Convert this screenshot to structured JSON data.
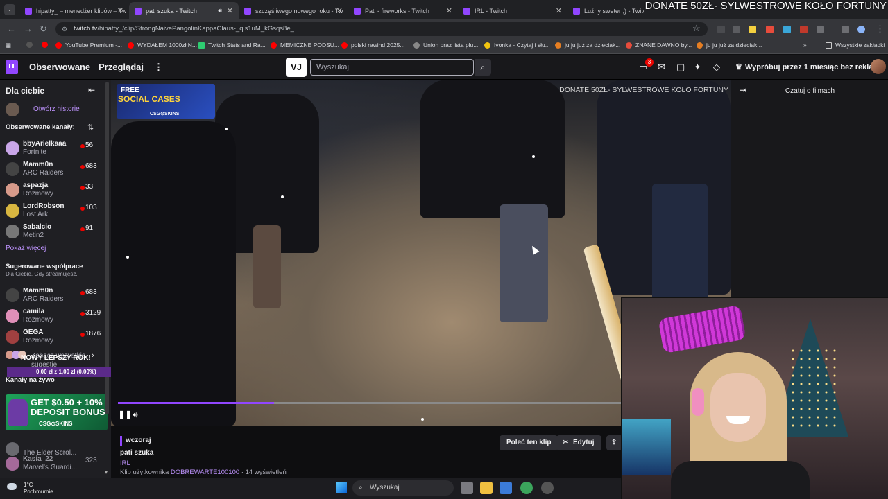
{
  "browser": {
    "tabs": [
      {
        "label": "hipatty_ – menedżer klipów – Tw",
        "active": false
      },
      {
        "label": "pati szuka - Twitch",
        "active": true
      },
      {
        "label": "szczęśliwego nowego roku - Tw",
        "active": false
      },
      {
        "label": "Pati - fireworks - Twitch",
        "active": false
      },
      {
        "label": "IRL - Twitch",
        "active": false
      },
      {
        "label": "Luźny sweter ;) - Twitch",
        "active": false
      }
    ],
    "url_host": "twitch.tv",
    "url_path": "/hipatty_/clip/StrongNaivePangolinKappaClaus-_qis1uM_kGsqs8e_",
    "bookmarks": [
      "YouTube Premium -...",
      "WYDAŁEM 1000zł N...",
      "Twitch Stats and Ra...",
      "MEMICZNE PODSU...",
      "polski rewind 2025...",
      "Union oraz lista plu...",
      "Ivonka - Czytaj i słu...",
      "ju ju już za dzieciak...",
      "ZNANE DAWNO by...",
      "ju ju już za dzieciak..."
    ],
    "all_bookmarks": "Wszystkie zakładki"
  },
  "stream_banner": "DONATE 50ZŁ- SYLWESTROWE KOŁO FORTUNY",
  "twitch_nav": {
    "following": "Obserwowane",
    "browse": "Przeglądaj",
    "search_placeholder": "Wyszukaj",
    "extension_label": "VJ",
    "notifications_count": "3",
    "promo": "Wypróbuj przez 1 miesiąc bez reklam"
  },
  "sidebar": {
    "title": "Dla ciebie",
    "open_stories": "Otwórz historie",
    "followed_heading": "Obserwowane kanały:",
    "followed": [
      {
        "name": "bbyArielkaaa",
        "category": "Fortnite",
        "viewers": "56",
        "color": "#c9a6e8"
      },
      {
        "name": "Mamm0n",
        "category": "ARC Raiders",
        "viewers": "683",
        "color": "#444"
      },
      {
        "name": "aspazja",
        "category": "Rozmowy",
        "viewers": "33",
        "color": "#d79a8a"
      },
      {
        "name": "LordRobson",
        "category": "Lost Ark",
        "viewers": "103",
        "color": "#d8b640"
      },
      {
        "name": "Sabalcio",
        "category": "Metin2",
        "viewers": "91",
        "color": "#777"
      }
    ],
    "show_more": "Pokaż więcej",
    "suggested_heading": "Sugerowane współprace",
    "suggested_sub": "Dla Ciebie. Gdy streamujesz.",
    "suggested": [
      {
        "name": "Mamm0n",
        "category": "ARC Raiders",
        "viewers": "683",
        "color": "#444"
      },
      {
        "name": "camila",
        "category": "Rozmowy",
        "viewers": "3129",
        "color": "#e08fb8"
      },
      {
        "name": "GEGA",
        "category": "Rozmowy",
        "viewers": "1876",
        "color": "#a04040"
      }
    ],
    "see_all": "Zobacz wszystkie sugestie",
    "live_heading": "Kanały na żywo",
    "ad_line1": "GET $0.50 + 10%",
    "ad_line2": "DEPOSIT BONUS",
    "ad_brand": "CSG⊙SKINS",
    "ny_text": "NOWY LEPSZY ROK!",
    "ny_price": "0,00 zł z 1,00 zł (0.00%)",
    "partial_channels": [
      {
        "category": "The Elder Scrol...",
        "viewers": ""
      },
      {
        "name": "Kasia_22",
        "category": "Marvel's Guardi...",
        "viewers": "323"
      }
    ]
  },
  "video": {
    "overlay_line1": "FREE",
    "overlay_line2": "SOCIAL CASES",
    "overlay_brand": "CSG⊙SKINS",
    "progress": 0.31
  },
  "chat": {
    "title": "Czatuj o filmach"
  },
  "clip_info": {
    "date": "wczoraj",
    "title": "pati szuka",
    "category": "IRL",
    "meta_prefix": "Klip użytkownika",
    "author": "DOBREWARTE100100",
    "meta_suffix": "· 14 wyświetleń",
    "recommend_btn": "Poleć ten klip",
    "edit_btn": "Edytuj"
  },
  "taskbar": {
    "temperature": "1°C",
    "weather": "Pochmurnie",
    "search_placeholder": "Wyszukaj"
  }
}
